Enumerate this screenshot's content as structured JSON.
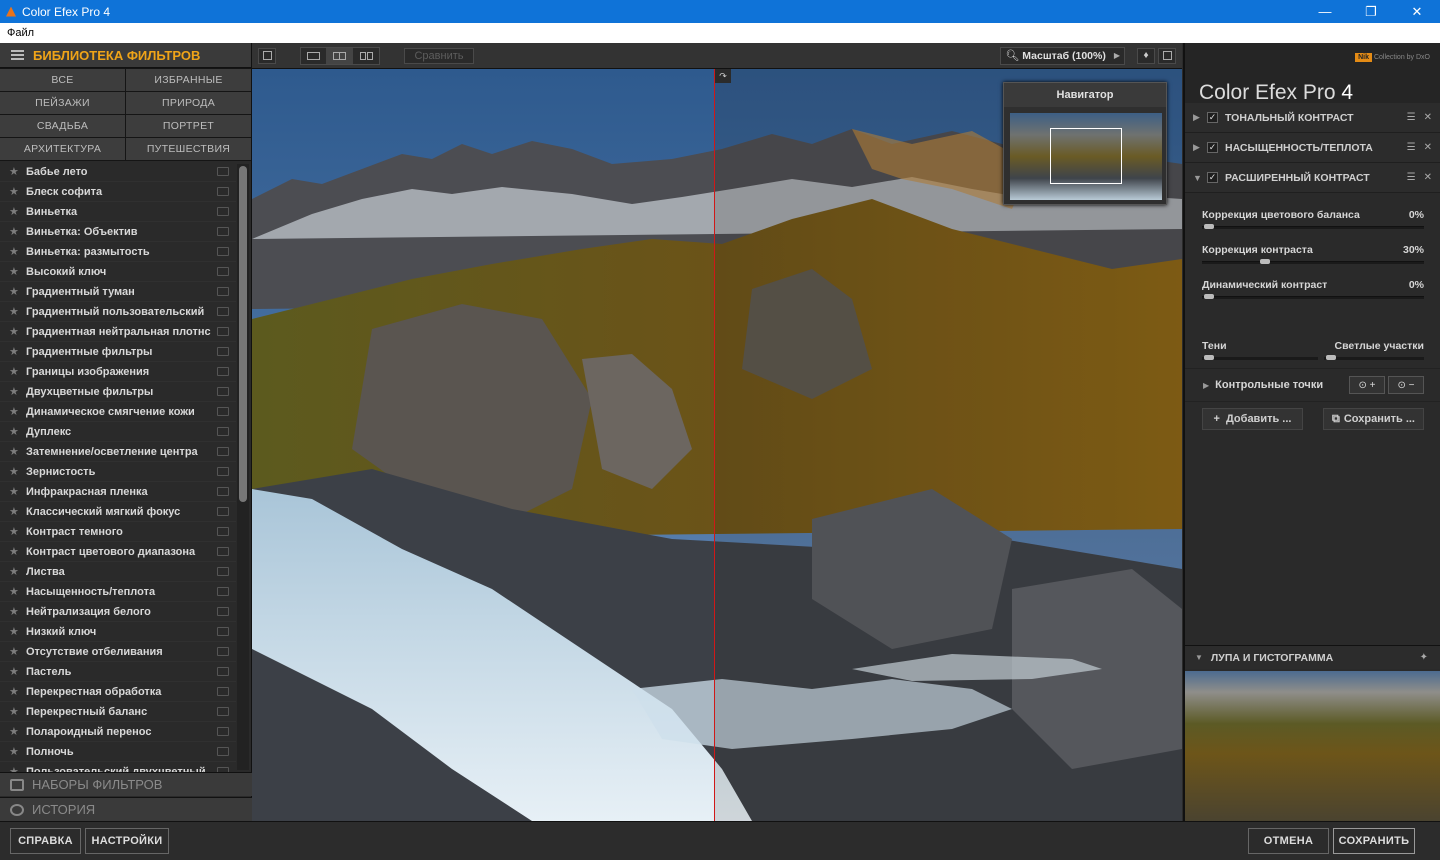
{
  "window": {
    "title": "Color Efex Pro 4",
    "minimize": "—",
    "maximize": "❐",
    "close": "✕"
  },
  "menu": {
    "file": "Файл"
  },
  "library": {
    "title": "БИБЛИОТЕКА ФИЛЬТРОВ",
    "categories": [
      "ВСЕ",
      "ИЗБРАННЫЕ",
      "ПЕЙЗАЖИ",
      "ПРИРОДА",
      "СВАДЬБА",
      "ПОРТРЕТ",
      "АРХИТЕКТУРА",
      "ПУТЕШЕСТВИЯ"
    ],
    "filters": [
      "Бабье лето",
      "Блеск софита",
      "Виньетка",
      "Виньетка: Объектив",
      "Виньетка: размытость",
      "Высокий ключ",
      "Градиентный туман",
      "Градиентный пользовательский",
      "Градиентная нейтральная плотнс",
      "Градиентные фильтры",
      "Границы изображения",
      "Двухцветные фильтры",
      "Динамическое смягчение кожи",
      "Дуплекс",
      "Затемнение/осветление центра",
      "Зернистость",
      "Инфракрасная пленка",
      "Классический мягкий фокус",
      "Контраст темного",
      "Контраст цветового диапазона",
      "Листва",
      "Насыщенность/теплота",
      "Нейтрализация белого",
      "Низкий ключ",
      "Отсутствие отбеливания",
      "Пастель",
      "Перекрестная обработка",
      "Перекрестный баланс",
      "Полароидный перенос",
      "Полночь",
      "Пользовательский двухцветный"
    ],
    "presets": "НАБОРЫ ФИЛЬТРОВ",
    "history": "ИСТОРИЯ"
  },
  "toolbar": {
    "compare": "Сравнить",
    "zoom": "Масштаб (100%)"
  },
  "navigator": {
    "title": "Навигатор"
  },
  "right": {
    "brand": "Color Efex Pro",
    "brand_num": "4",
    "nik": "Nik",
    "nik_sub": "Collection by DxO",
    "effects": [
      "ТОНАЛЬНЫЙ КОНТРАСТ",
      "НАСЫЩЕННОСТЬ/ТЕПЛОТА",
      "РАСШИРЕННЫЙ КОНТРАСТ"
    ],
    "sliders": [
      {
        "name": "Коррекция цветового баланса",
        "value": "0%",
        "level": 0.0
      },
      {
        "name": "Коррекция контраста",
        "value": "30%",
        "level": 0.3
      },
      {
        "name": "Динамический контраст",
        "value": "0%",
        "level": 0.0
      }
    ],
    "shadows": "Тени",
    "highlights": "Светлые участки",
    "control_points": "Контрольные точки",
    "add": "Добавить ...",
    "save": "Сохранить ...",
    "loupe": "ЛУПА И ГИСТОГРАММА"
  },
  "bottom": {
    "help": "СПРАВКА",
    "settings": "НАСТРОЙКИ",
    "cancel": "ОТМЕНА",
    "save": "СОХРАНИТЬ"
  }
}
